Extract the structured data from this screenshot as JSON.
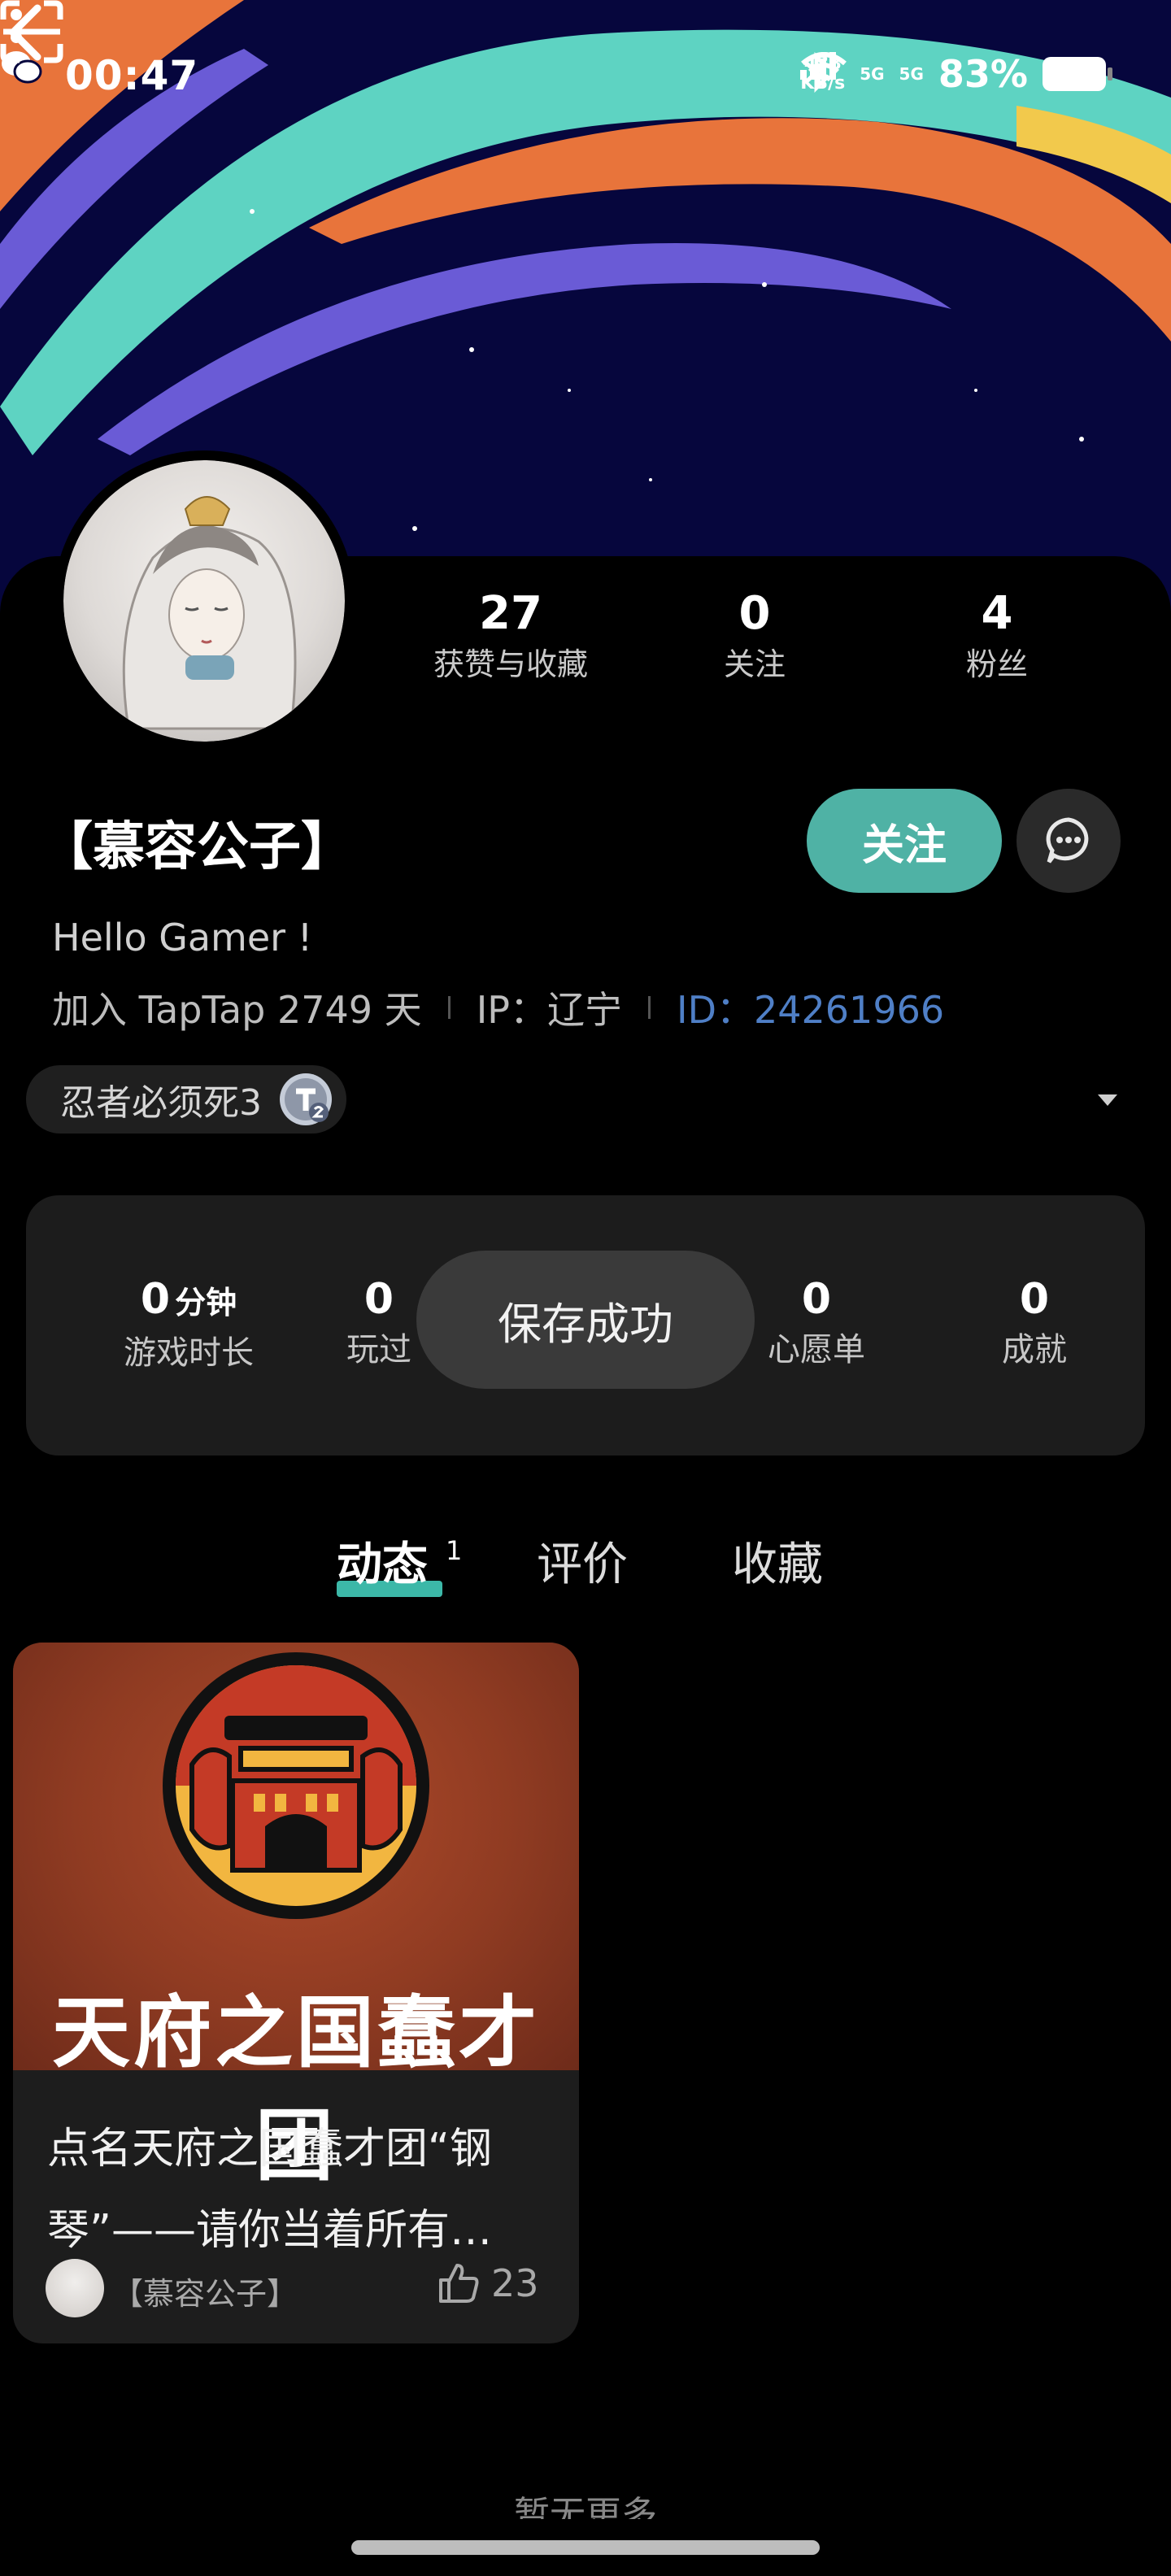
{
  "status_bar": {
    "time": "00:47",
    "speed_value": "438",
    "speed_unit": "KB/s",
    "signal_1": "5G",
    "signal_2": "5G",
    "battery": "83%"
  },
  "profile": {
    "username": "【慕容公子】",
    "bio": "Hello Gamer !",
    "joined": "加入 TapTap 2749 天",
    "ip": "IP：辽宁",
    "id": "ID：24261966",
    "follow_button": "关注",
    "stats": [
      {
        "value": "27",
        "label": "获赞与收藏"
      },
      {
        "value": "0",
        "label": "关注"
      },
      {
        "value": "4",
        "label": "粉丝"
      }
    ],
    "game_chip": "忍者必须死3"
  },
  "game_stats": {
    "playtime_value": "0",
    "playtime_unit": "分钟",
    "playtime_label": "游戏时长",
    "played_value": "0",
    "played_label": "玩过",
    "wishlist_value": "0",
    "wishlist_label": "心愿单",
    "achievement_value": "0",
    "achievement_label": "成就"
  },
  "toast": "保存成功",
  "tabs": [
    {
      "label": "动态",
      "count": "1",
      "active": true
    },
    {
      "label": "评价",
      "active": false
    },
    {
      "label": "收藏",
      "active": false
    }
  ],
  "post": {
    "image_text": "天府之国蠢才团",
    "title_line1": "点名天府之国蠢才团“钢",
    "title_line2": "琴”——请你当着所有…",
    "author": "【慕容公子】",
    "likes": "23"
  },
  "footer_hint": "暂无更多",
  "colors": {
    "accent": "#4fb2a5",
    "id_link": "#4f7fc6",
    "banner_bg": "#06063d"
  },
  "icons": [
    "back-icon",
    "scan-icon",
    "more-icon",
    "message-icon",
    "like-icon",
    "dropdown-icon",
    "wechat-icon",
    "bluetooth-icon",
    "wifi-icon",
    "battery-icon"
  ]
}
